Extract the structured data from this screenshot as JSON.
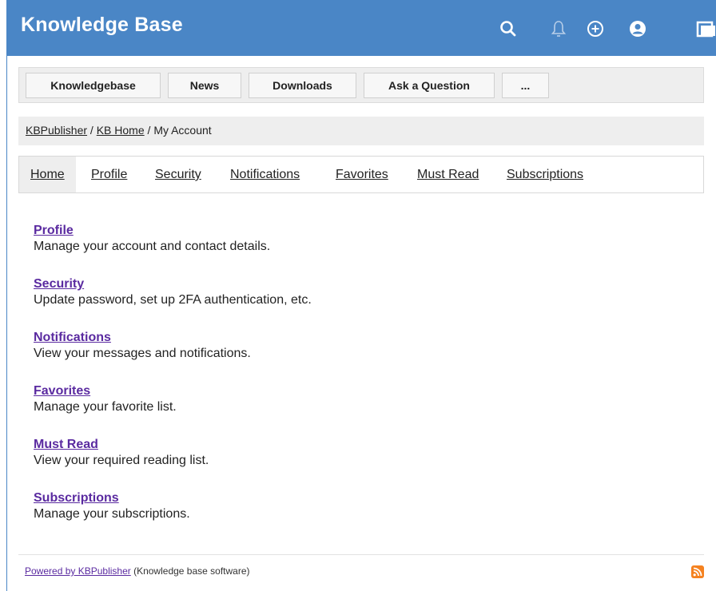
{
  "app": {
    "title": "Knowledge Base",
    "icons": [
      "search-icon",
      "bell-icon",
      "plus-circle-icon",
      "user-circle-icon",
      "window-icon"
    ]
  },
  "menu": {
    "items": [
      "Knowledgebase",
      "News",
      "Downloads",
      "Ask a Question",
      "..."
    ]
  },
  "breadcrumb": {
    "items": [
      "KBPublisher",
      "KB Home",
      "My Account"
    ],
    "separator": " / "
  },
  "tabs": [
    {
      "label": "Home",
      "active": true
    },
    {
      "label": "Profile",
      "active": false
    },
    {
      "label": "Security",
      "active": false
    },
    {
      "label": "Notifications",
      "active": false
    },
    {
      "label": "Favorites",
      "active": false
    },
    {
      "label": "Must Read",
      "active": false
    },
    {
      "label": "Subscriptions",
      "active": false
    }
  ],
  "sections": [
    {
      "title": "Profile",
      "desc": "Manage your account and contact details."
    },
    {
      "title": "Security",
      "desc": "Update password, set up 2FA authentication, etc."
    },
    {
      "title": "Notifications",
      "desc": "View your messages and notifications."
    },
    {
      "title": "Favorites",
      "desc": "Manage your favorite list."
    },
    {
      "title": "Must Read",
      "desc": "View your required reading list."
    },
    {
      "title": "Subscriptions",
      "desc": "Manage your subscriptions."
    }
  ],
  "footer": {
    "link": "Powered by KBPublisher",
    "text": " (Knowledge base software)"
  },
  "colors": {
    "header": "#4a86c6",
    "link": "#5a2aa0",
    "rss": "#f58220"
  }
}
